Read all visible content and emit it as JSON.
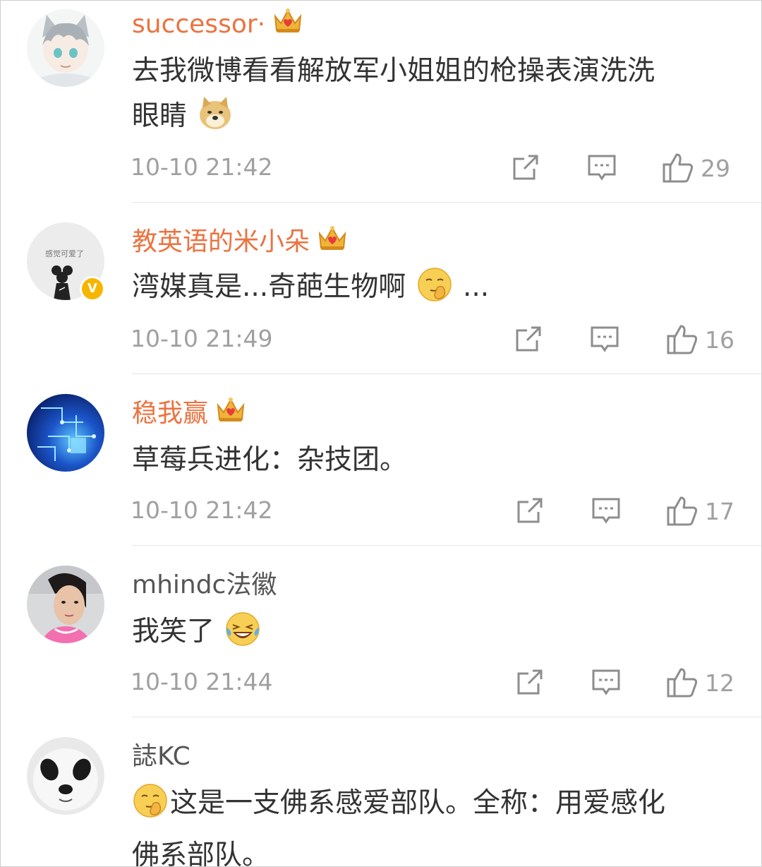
{
  "comments": [
    {
      "username": "successor·",
      "text_1": "去我微博看看解放军小姐姐的枪操表演洗洗",
      "text_2": "眼睛",
      "time": "10-10 21:42",
      "likes": "29",
      "username_color": "#eb7340"
    },
    {
      "username": "教英语的米小朵",
      "text_1": "湾媒真是...奇葩生物啊",
      "text_2": "...",
      "time": "10-10 21:49",
      "likes": "16",
      "username_color": "#eb7340",
      "verified": true
    },
    {
      "username": "稳我赢",
      "text_1": "草莓兵进化：杂技团。",
      "time": "10-10 21:42",
      "likes": "17",
      "username_color": "#eb7340"
    },
    {
      "username": "mhindc法徽",
      "text_1": "我笑了",
      "time": "10-10 21:44",
      "likes": "12",
      "username_color": "#555555"
    },
    {
      "username": "誌KC",
      "text_1": "这是一支佛系感爱部队。全称：用爱感化",
      "text_2": "佛系部队。",
      "username_color": "#555555"
    }
  ],
  "icons": {
    "share": "share-icon",
    "reply": "comment-icon",
    "like": "thumbs-up-icon",
    "member": "crown-icon"
  }
}
